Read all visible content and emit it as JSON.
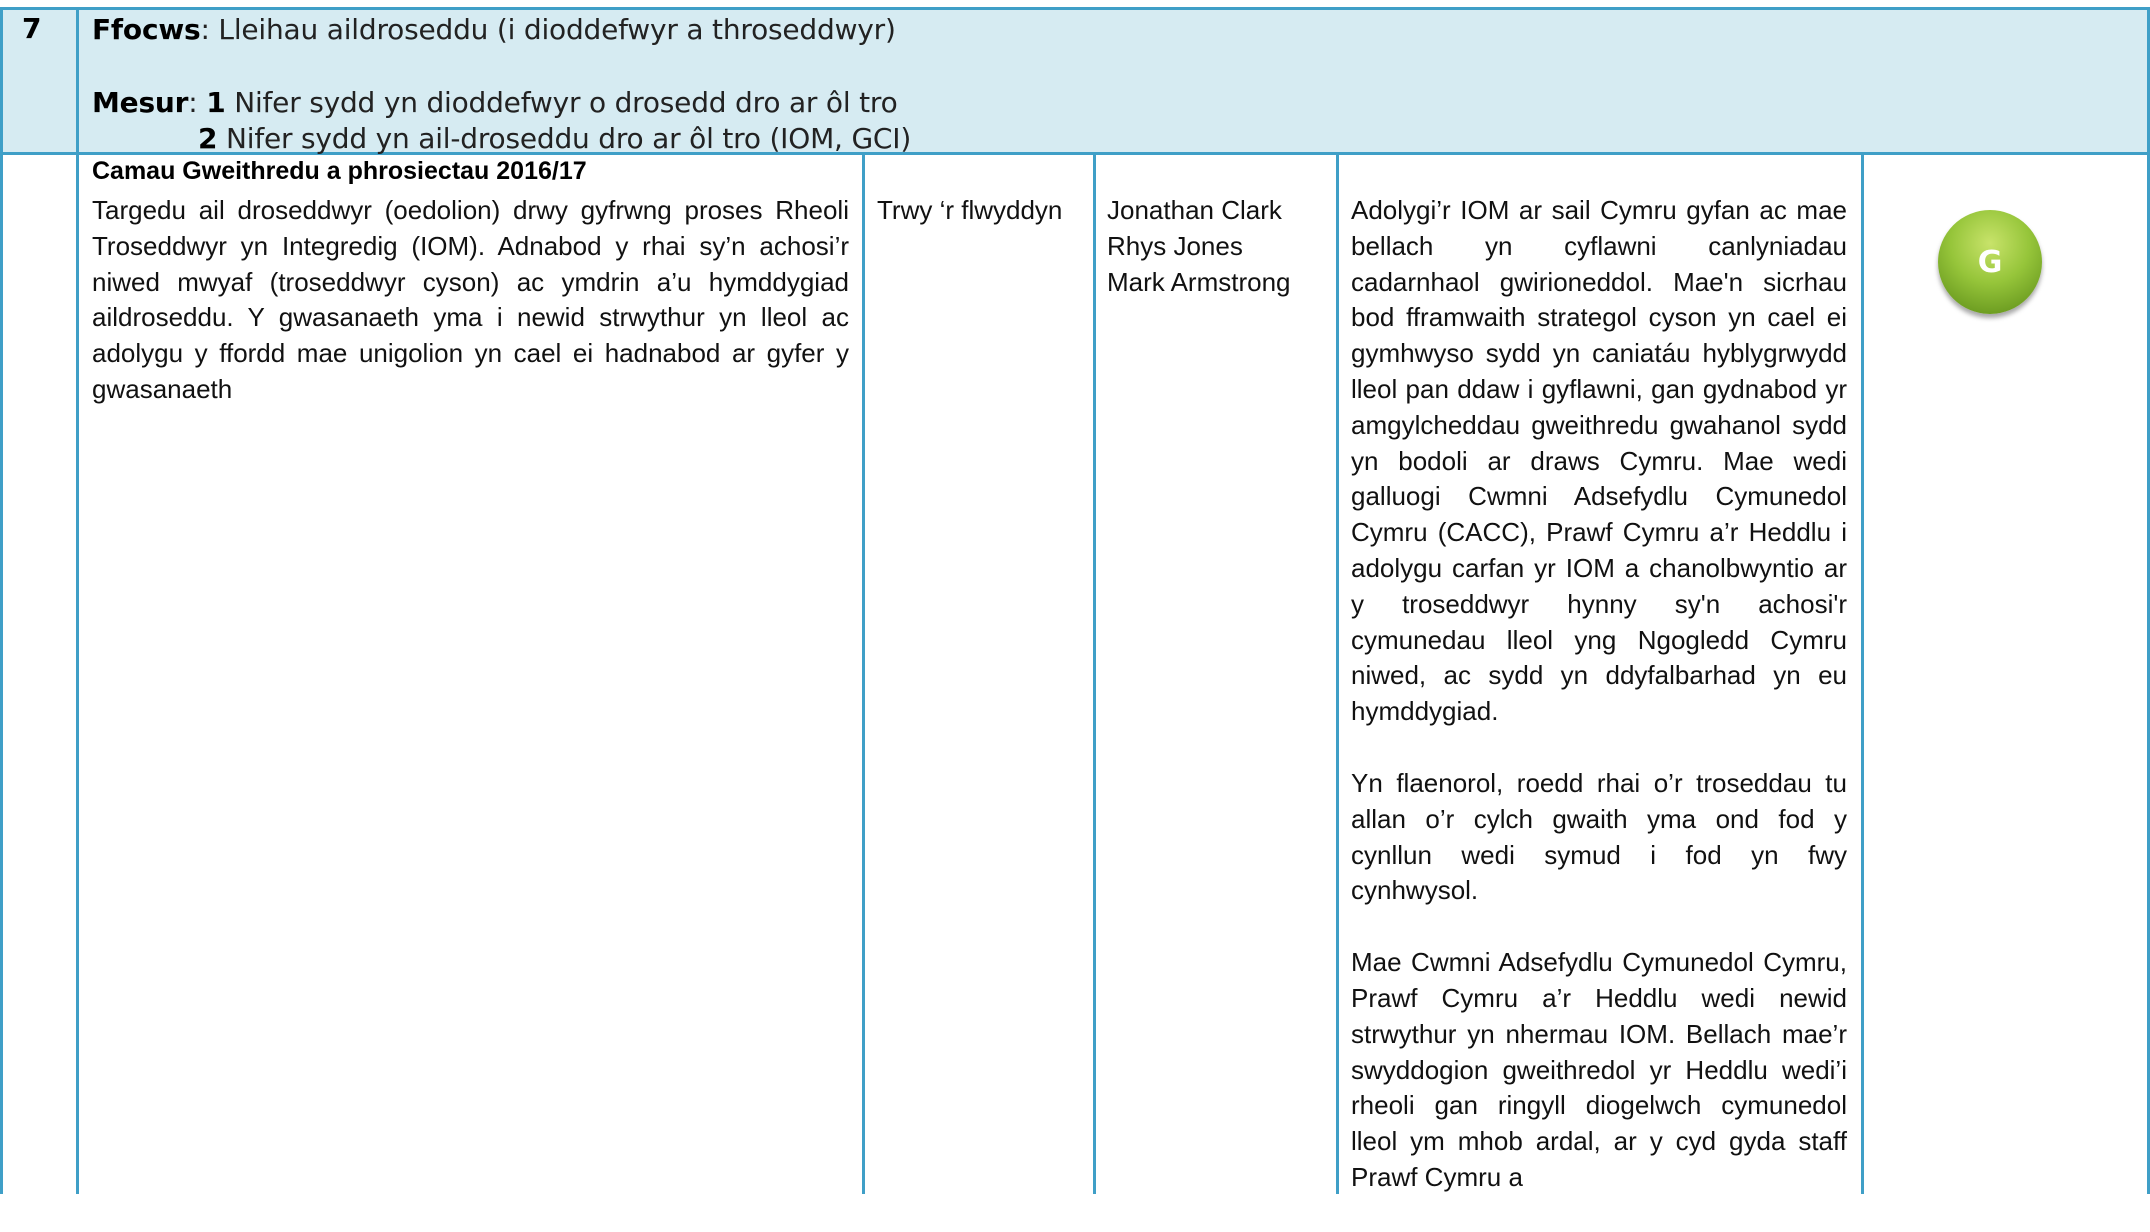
{
  "header": {
    "row_number": "7",
    "focus_label": "Ffocws",
    "focus_text": "Lleihau aildroseddu (i dioddefwyr a throseddwyr)",
    "measure_label": "Mesur",
    "measures": [
      {
        "number": "1",
        "text": "Nifer sydd yn dioddefwyr o drosedd dro ar ôl tro"
      },
      {
        "number": "2",
        "text": "Nifer sydd yn ail-droseddu dro ar ôl tro (IOM, GCI)"
      }
    ]
  },
  "row": {
    "section_title": "Camau Gweithredu a phrosiectau 2016/17",
    "action_text": "Targedu ail droseddwyr (oedolion) drwy gyfrwng proses Rheoli Troseddwyr yn Integredig (IOM). Adnabod y rhai sy’n achosi’r niwed mwyaf (troseddwyr cyson) ac ymdrin a’u hymddygiad aildroseddu. Y gwasanaeth yma i newid strwythur yn  lleol ac adolygu y ffordd mae unigolion yn cael ei hadnabod ar gyfer y gwasanaeth",
    "timescale": "Trwy ‘r flwyddyn",
    "leads": [
      "Jonathan Clark",
      "Rhys Jones",
      "Mark Armstrong"
    ],
    "progress_paragraphs": [
      "Adolygi’r IOM ar sail Cymru gyfan ac mae bellach yn cyflawni canlyniadau cadarnhaol gwirioneddol. Mae'n sicrhau bod fframwaith strategol cyson yn cael ei gymhwyso sydd yn caniatáu hyblygrwydd lleol pan ddaw i gyflawni, gan gydnabod yr amgylcheddau gweithredu gwahanol sydd yn bodoli ar draws Cymru. Mae wedi galluogi Cwmni Adsefydlu Cymunedol Cymru (CACC), Prawf Cymru a’r Heddlu i adolygu carfan yr IOM a chanolbwyntio ar y troseddwyr hynny sy'n achosi'r cymunedau lleol yng Ngogledd Cymru niwed, ac sydd yn ddyfalbarhad yn eu hymddygiad.",
      "Yn flaenorol, roedd rhai o’r troseddau tu allan o’r cylch gwaith yma ond fod y cynllun wedi symud i fod yn fwy cynhwysol.",
      "Mae Cwmni Adsefydlu Cymunedol Cymru, Prawf Cymru a’r Heddlu wedi newid strwythur yn nhermau IOM. Bellach mae’r swyddogion gweithredol yr Heddlu wedi’i rheoli gan ringyll diogelwch cymunedol lleol ym mhob ardal, ar y cyd gyda staff Prawf Cymru a"
    ],
    "status": "G",
    "status_color": "#96c53a"
  },
  "colors": {
    "border": "#3f9fc7",
    "header_background": "#d6ebf2"
  }
}
